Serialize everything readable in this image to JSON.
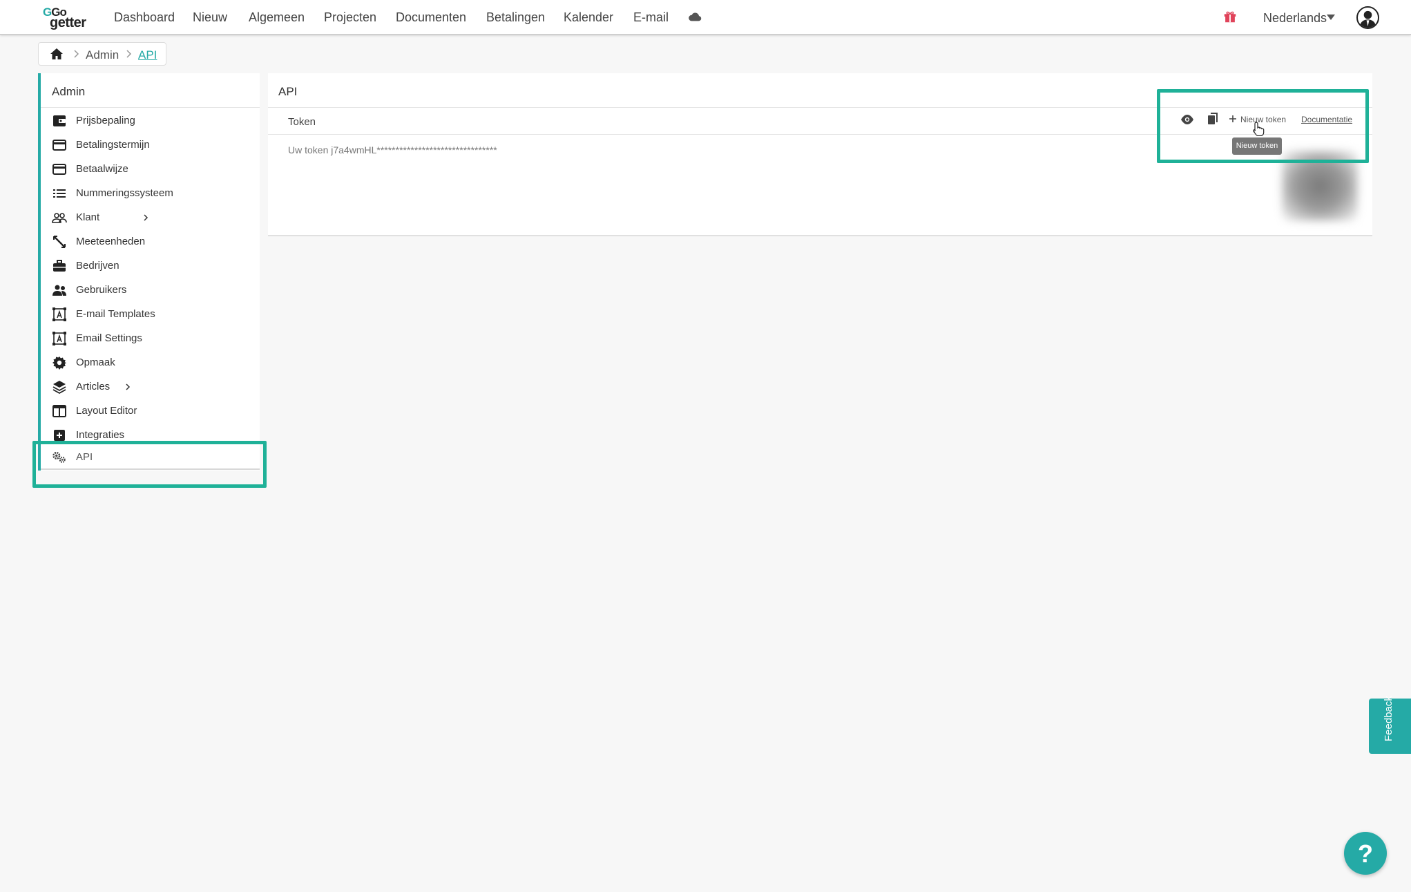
{
  "brand": {
    "logo_top": "Go",
    "logo_bottom": "getter",
    "accent": "#25aaa6",
    "highlight": "#1fb198"
  },
  "nav": {
    "items": [
      "Dashboard",
      "Nieuw",
      "Algemeen",
      "Projecten",
      "Documenten",
      "Betalingen",
      "Kalender",
      "E-mail"
    ],
    "cloud_icon": "cloud-icon",
    "gift_icon": "gift-icon",
    "language": "Nederlands",
    "avatar_icon": "user-avatar-icon"
  },
  "breadcrumb": {
    "home_icon": "home-icon",
    "items": [
      "Admin",
      "API"
    ]
  },
  "sidebar": {
    "title": "Admin",
    "items": [
      {
        "label": "Prijsbepaling",
        "icon": "wallet-icon"
      },
      {
        "label": "Betalingstermijn",
        "icon": "credit-card-icon"
      },
      {
        "label": "Betaalwijze",
        "icon": "credit-card-icon"
      },
      {
        "label": "Nummeringssysteem",
        "icon": "list-icon"
      },
      {
        "label": "Klant",
        "icon": "customers-icon",
        "has_submenu": true
      },
      {
        "label": "Meeteenheden",
        "icon": "measure-icon"
      },
      {
        "label": "Bedrijven",
        "icon": "briefcase-icon"
      },
      {
        "label": "Gebruikers",
        "icon": "users-icon"
      },
      {
        "label": "E-mail Templates",
        "icon": "text-frame-icon"
      },
      {
        "label": "Email Settings",
        "icon": "text-frame-icon"
      },
      {
        "label": "Opmaak",
        "icon": "gear-icon"
      },
      {
        "label": "Articles",
        "icon": "layers-icon",
        "has_submenu": true
      },
      {
        "label": "Layout Editor",
        "icon": "layout-icon"
      },
      {
        "label": "Integraties",
        "icon": "plus-square-icon"
      },
      {
        "label": "API",
        "icon": "gears-icon",
        "active": true
      }
    ]
  },
  "api_panel": {
    "title": "API",
    "token_header": "Token",
    "token_value": "Uw token j7a4wmHL********************************",
    "actions": {
      "show_icon": "eye-icon",
      "copy_icon": "copy-icon",
      "new_token": "Nieuw token",
      "documentation": "Documentatie"
    },
    "tooltip": "Nieuw token"
  },
  "feedback": "Feedback",
  "help": "?"
}
